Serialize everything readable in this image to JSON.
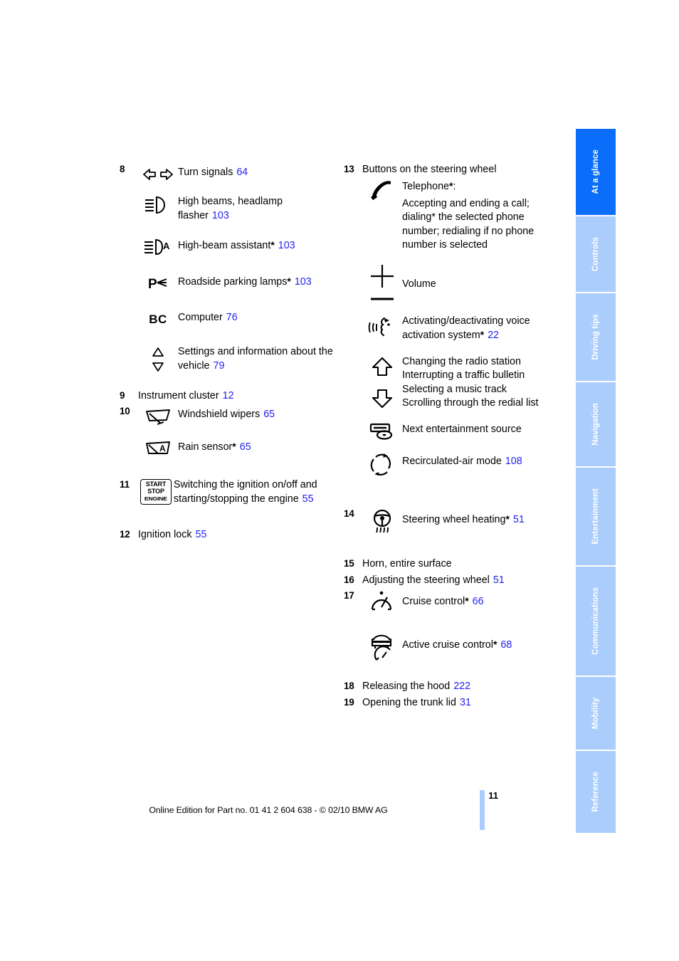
{
  "page": {
    "number": "11",
    "footnote": "Online Edition for Part no. 01 41 2 604 638 - © 02/10 BMW AG",
    "ref_color": "#2222ee",
    "tab_active_color": "#0a6efa",
    "tab_inactive_color": "#abcdfc"
  },
  "tabs": [
    {
      "label": "At a glance",
      "active": true
    },
    {
      "label": "Controls",
      "active": false
    },
    {
      "label": "Driving tips",
      "active": false
    },
    {
      "label": "Navigation",
      "active": false
    },
    {
      "label": "Entertainment",
      "active": false
    },
    {
      "label": "Communications",
      "active": false
    },
    {
      "label": "Mobility",
      "active": false
    },
    {
      "label": "Reference",
      "active": false
    }
  ],
  "left_column": {
    "item8": {
      "number": "8",
      "rows": [
        {
          "icon": "turn-signals-icon",
          "label": "Turn signals",
          "ref": "64"
        },
        {
          "icon": "high-beams-headlamp-flasher-icon",
          "label": "High beams, headlamp flasher",
          "ref": "103"
        },
        {
          "icon": "high-beam-assistant-icon",
          "label": "High-beam assistant",
          "star": "*",
          "ref": "103"
        },
        {
          "icon": "roadside-parking-lamps-icon",
          "label": "Roadside parking lamps",
          "star": "*",
          "ref": "103"
        },
        {
          "icon": "computer-bc-icon",
          "label": "Computer",
          "ref": "76"
        },
        {
          "icon": "up-down-arrows-icon",
          "label": "Settings and information about the vehicle",
          "ref": "79"
        }
      ]
    },
    "item9": {
      "number": "9",
      "label": "Instrument cluster",
      "ref": "12"
    },
    "item10": {
      "number": "10",
      "rows": [
        {
          "icon": "windshield-wipers-icon",
          "label": "Windshield wipers",
          "ref": "65"
        },
        {
          "icon": "rain-sensor-icon",
          "label": "Rain sensor",
          "star": "*",
          "ref": "65"
        }
      ]
    },
    "item11": {
      "number": "11",
      "icon": "start-stop-engine-icon",
      "icon_text": {
        "line1": "START",
        "line2": "STOP",
        "line3": "ENGINE"
      },
      "label": "Switching the ignition on/off and starting/stopping the engine",
      "ref": "55"
    },
    "item12": {
      "number": "12",
      "label": "Ignition lock",
      "ref": "55"
    }
  },
  "right_column": {
    "item13": {
      "number": "13",
      "heading": "Buttons on the steering wheel",
      "rows": [
        {
          "icon": "telephone-handset-icon",
          "label": "Telephone",
          "star": "*",
          "suffix": ":",
          "detail": "Accepting and ending a call; dialing* the selected phone number; redialing if no phone number is selected"
        },
        {
          "icon": "volume-plus-minus-icon",
          "label": "Volume"
        },
        {
          "icon": "voice-activation-icon",
          "label": "Activating/deactivating voice activation system",
          "star": "*",
          "ref": "22"
        },
        {
          "icon": "up-down-thick-arrows-icon",
          "lines": [
            "Changing the radio station",
            "Interrupting a traffic bulletin",
            "Selecting a music track",
            "Scrolling through the redial list"
          ]
        },
        {
          "icon": "entertainment-source-icon",
          "label": "Next entertainment source"
        },
        {
          "icon": "recirculated-air-icon",
          "label": "Recirculated-air mode",
          "ref": "108"
        }
      ]
    },
    "item14": {
      "number": "14",
      "icon": "steering-wheel-heating-icon",
      "label": "Steering wheel heating",
      "star": "*",
      "ref": "51"
    },
    "item15": {
      "number": "15",
      "label": "Horn, entire surface"
    },
    "item16": {
      "number": "16",
      "label": "Adjusting the steering wheel",
      "ref": "51"
    },
    "item17": {
      "number": "17",
      "rows": [
        {
          "icon": "cruise-control-icon",
          "label": "Cruise control",
          "star": "*",
          "ref": "66"
        },
        {
          "icon": "active-cruise-control-icon",
          "label": "Active cruise control",
          "star": "*",
          "ref": "68"
        }
      ]
    },
    "item18": {
      "number": "18",
      "label": "Releasing the hood",
      "ref": "222"
    },
    "item19": {
      "number": "19",
      "label": "Opening the trunk lid",
      "ref": "31"
    }
  }
}
